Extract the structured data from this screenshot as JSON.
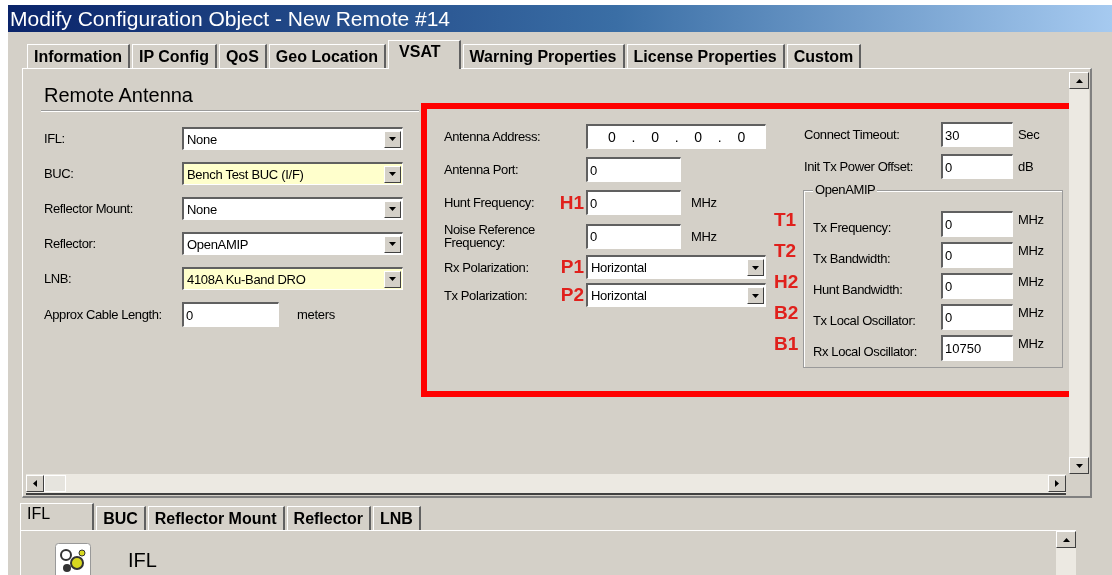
{
  "window": {
    "title": "Modify Configuration Object - New Remote #14"
  },
  "tabs": [
    {
      "label": "Information",
      "selected": false
    },
    {
      "label": "IP Config",
      "selected": false
    },
    {
      "label": "QoS",
      "selected": false
    },
    {
      "label": "Geo Location",
      "selected": false
    },
    {
      "label": "VSAT",
      "selected": true
    },
    {
      "label": "Warning Properties",
      "selected": false
    },
    {
      "label": "License Properties",
      "selected": false
    },
    {
      "label": "Custom",
      "selected": false
    }
  ],
  "section_title": "Remote Antenna",
  "left_fields": [
    {
      "label": "IFL:",
      "kind": "dropdown",
      "value": "None",
      "highlighted": false
    },
    {
      "label": "BUC:",
      "kind": "dropdown",
      "value": "Bench Test BUC (I/F)",
      "highlighted": true
    },
    {
      "label": "Reflector Mount:",
      "kind": "dropdown",
      "value": "None",
      "highlighted": false
    },
    {
      "label": "Reflector:",
      "kind": "dropdown",
      "value": "OpenAMIP",
      "highlighted": false
    },
    {
      "label": "LNB:",
      "kind": "dropdown",
      "value": "4108A Ku-Band DRO",
      "highlighted": true
    },
    {
      "label": "Approx Cable Length:",
      "kind": "text",
      "value": "0",
      "unit": "meters"
    }
  ],
  "middle_fields": [
    {
      "label": "Antenna Address:",
      "kind": "ip",
      "octets": [
        "0",
        "0",
        "0",
        "0"
      ],
      "separator": "."
    },
    {
      "label": "Antenna Port:",
      "kind": "text",
      "value": "0"
    },
    {
      "label": "Hunt Frequency:",
      "marker": "H1",
      "kind": "text",
      "value": "0",
      "unit": "MHz"
    },
    {
      "label": "Noise Reference Frequency:",
      "kind": "text",
      "value": "0",
      "unit": "MHz"
    },
    {
      "label": "Rx Polarization:",
      "marker": "P1",
      "kind": "dropdown",
      "value": "Horizontal"
    },
    {
      "label": "Tx Polarization:",
      "marker": "P2",
      "kind": "dropdown",
      "value": "Horizontal"
    }
  ],
  "right_fields": [
    {
      "label": "Connect Timeout:",
      "value": "30",
      "unit": "Sec"
    },
    {
      "label": "Init Tx Power Offset:",
      "value": "0",
      "unit": "dB"
    }
  ],
  "openamip": {
    "title": "OpenAMIP",
    "fields": [
      {
        "marker": "T1",
        "label": "Tx Frequency:",
        "value": "0",
        "unit": "MHz"
      },
      {
        "marker": "T2",
        "label": "Tx Bandwidth:",
        "value": "0",
        "unit": "MHz"
      },
      {
        "marker": "H2",
        "label": "Hunt Bandwidth:",
        "value": "0",
        "unit": "MHz"
      },
      {
        "marker": "B2",
        "label": "Tx Local Oscillator:",
        "value": "0",
        "unit": "MHz"
      },
      {
        "marker": "B1",
        "label": "Rx Local Oscillator:",
        "value": "10750",
        "unit": "MHz"
      }
    ]
  },
  "bottom_tabs": [
    {
      "label": "IFL",
      "selected": true
    },
    {
      "label": "BUC",
      "selected": false
    },
    {
      "label": "Reflector Mount",
      "selected": false
    },
    {
      "label": "Reflector",
      "selected": false
    },
    {
      "label": "LNB",
      "selected": false
    }
  ],
  "detail": {
    "title": "IFL"
  }
}
